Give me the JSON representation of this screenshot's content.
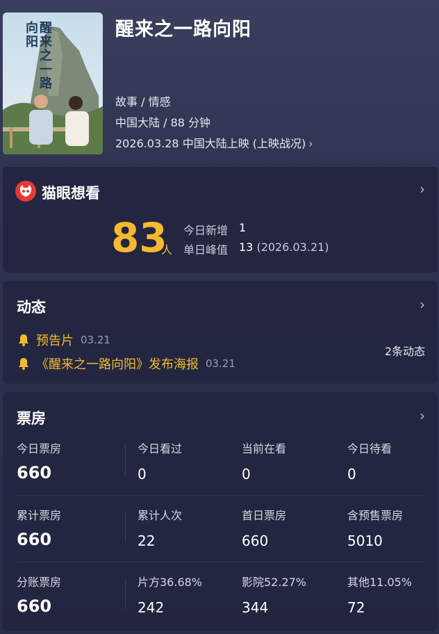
{
  "movie": {
    "poster_title": "醒来之一路向阳",
    "title": "醒来之一路向阳",
    "genre": "故事 / 情感",
    "region_duration": "中国大陆 / 88 分钟",
    "release": "2026.03.28 中国大陆上映 (上映战况)"
  },
  "want": {
    "title": "猫眼想看",
    "count": "83",
    "unit": "人",
    "today_new_label": "今日新增",
    "today_new_value": "1",
    "peak_label": "单日峰值",
    "peak_value": "13",
    "peak_date": "(2026.03.21)"
  },
  "feed": {
    "title": "动态",
    "items": [
      {
        "text": "预告片",
        "date": "03.21"
      },
      {
        "text": "《醒来之一路向阳》发布海报",
        "date": "03.21"
      }
    ],
    "count": "2条动态"
  },
  "box": {
    "title": "票房",
    "rows": [
      [
        {
          "label": "今日票房",
          "value": "660"
        },
        {
          "label": "今日看过",
          "value": "0"
        },
        {
          "label": "当前在看",
          "value": "0"
        },
        {
          "label": "今日待看",
          "value": "0"
        }
      ],
      [
        {
          "label": "累计票房",
          "value": "660"
        },
        {
          "label": "累计人次",
          "value": "22"
        },
        {
          "label": "首日票房",
          "value": "660"
        },
        {
          "label": "含预售票房",
          "value": "5010"
        }
      ],
      [
        {
          "label": "分账票房",
          "value": "660"
        },
        {
          "label": "片方36.68%",
          "value": "242"
        },
        {
          "label": "影院52.27%",
          "value": "344"
        },
        {
          "label": "其他11.05%",
          "value": "72"
        }
      ]
    ]
  },
  "colors": {
    "accent": "#f5b92f",
    "icon_red": "#e53935",
    "background": "#2f3351"
  }
}
